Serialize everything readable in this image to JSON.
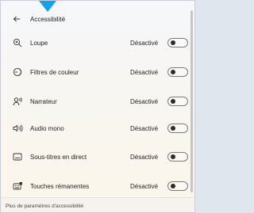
{
  "header": {
    "title": "Accessibilité"
  },
  "settings": [
    {
      "label": "Loupe",
      "state": "Désactivé",
      "icon": "zoom-icon"
    },
    {
      "label": "Filtres de couleur",
      "state": "Désactivé",
      "icon": "color-filter-icon"
    },
    {
      "label": "Narrateur",
      "state": "Désactivé",
      "icon": "narrator-icon"
    },
    {
      "label": "Audio mono",
      "state": "Désactivé",
      "icon": "mono-audio-icon"
    },
    {
      "label": "Sous-titres en direct",
      "state": "Désactivé",
      "icon": "captions-icon"
    },
    {
      "label": "Touches rémanentes",
      "state": "Désactivé",
      "icon": "sticky-keys-icon"
    }
  ],
  "footer": {
    "link": "Plus de paramètres d'accessibilité"
  },
  "colors": {
    "accent": "#1aa0e8",
    "toggle_off_knob": "#2b2b2b"
  }
}
